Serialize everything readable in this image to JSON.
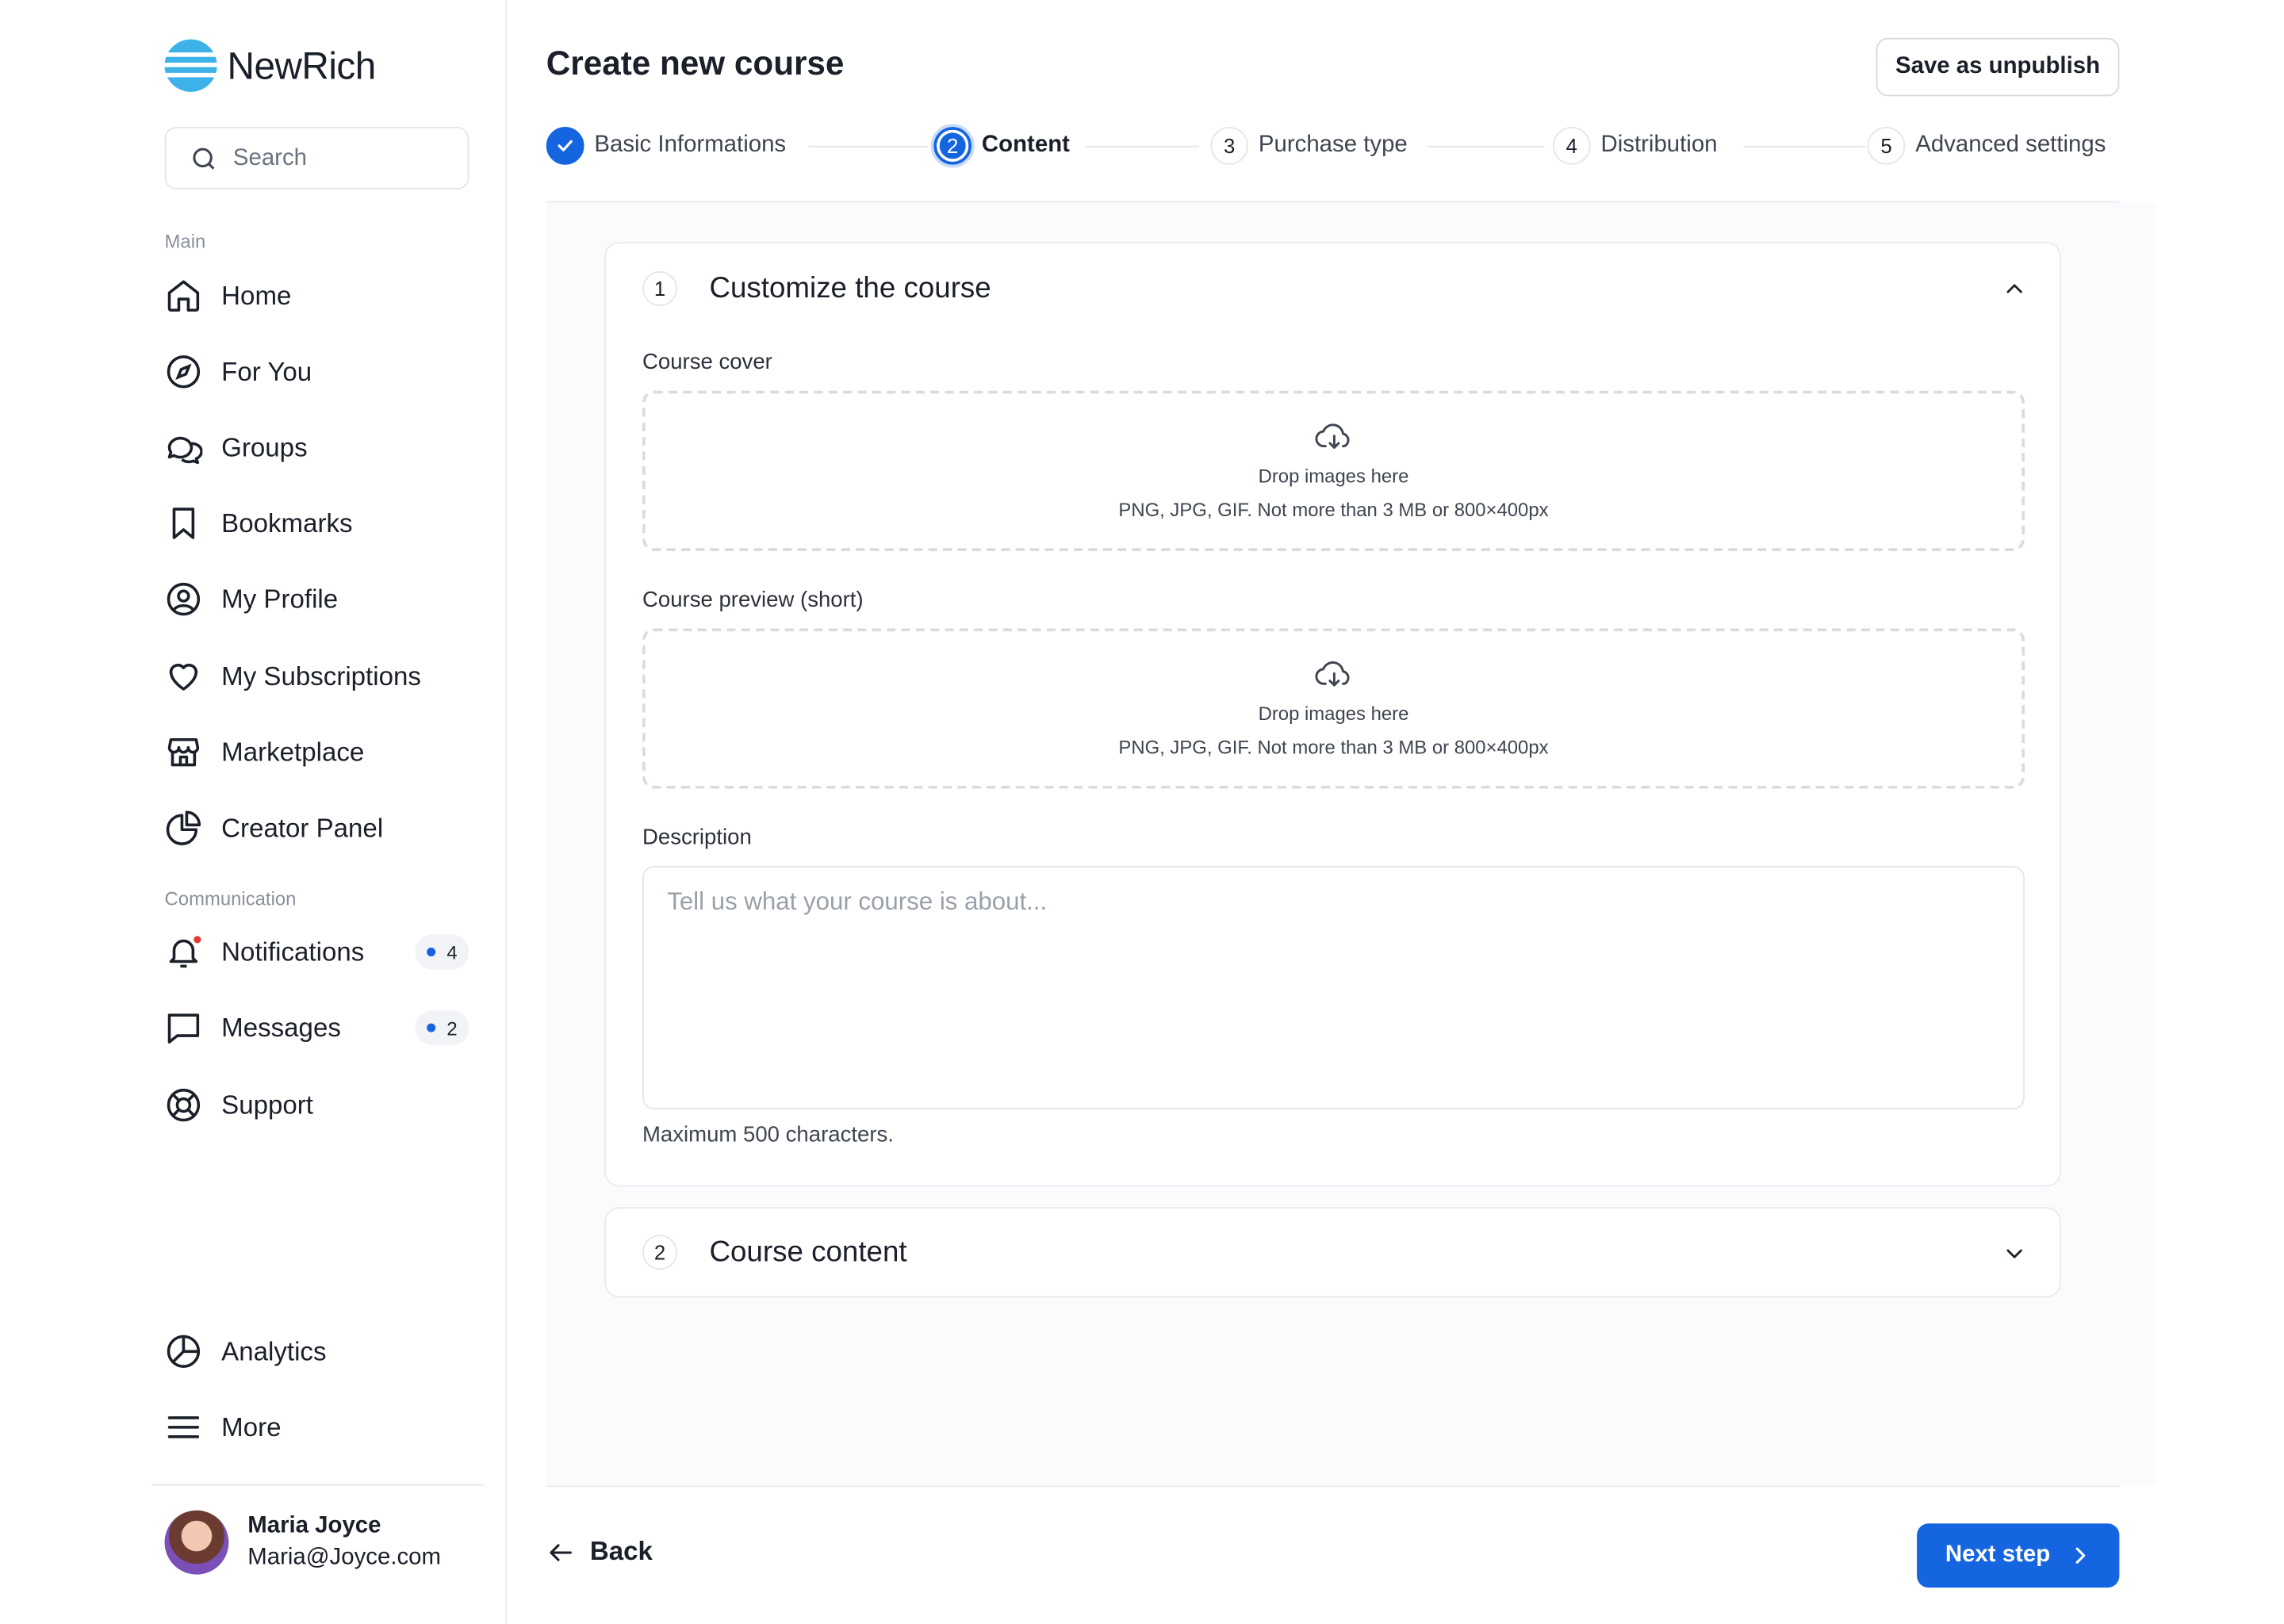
{
  "brand": {
    "name": "NewRich",
    "accent": "#3db2e8"
  },
  "search": {
    "placeholder": "Search"
  },
  "sidebar": {
    "main_label": "Main",
    "main_items": [
      {
        "label": "Home",
        "icon": "home-icon"
      },
      {
        "label": "For You",
        "icon": "compass-icon"
      },
      {
        "label": "Groups",
        "icon": "chat-bubbles-icon"
      },
      {
        "label": "Bookmarks",
        "icon": "bookmark-icon"
      },
      {
        "label": "My Profile",
        "icon": "user-circle-icon"
      },
      {
        "label": "My Subscriptions",
        "icon": "heart-icon"
      },
      {
        "label": "Marketplace",
        "icon": "store-icon"
      },
      {
        "label": "Creator Panel",
        "icon": "pie-chart-icon"
      }
    ],
    "communication_label": "Communication",
    "communication_items": [
      {
        "label": "Notifications",
        "icon": "bell-icon",
        "badge": "4"
      },
      {
        "label": "Messages",
        "icon": "message-icon",
        "badge": "2"
      },
      {
        "label": "Support",
        "icon": "lifebuoy-icon"
      }
    ],
    "bottom_items": [
      {
        "label": "Analytics",
        "icon": "analytics-icon"
      },
      {
        "label": "More",
        "icon": "menu-icon"
      }
    ],
    "user": {
      "name": "Maria Joyce",
      "email": "Maria@Joyce.com"
    }
  },
  "header": {
    "title": "Create new course",
    "save_label": "Save as unpublish"
  },
  "steps": [
    {
      "number": "1",
      "label": "Basic Informations",
      "state": "done"
    },
    {
      "number": "2",
      "label": "Content",
      "state": "active"
    },
    {
      "number": "3",
      "label": "Purchase type",
      "state": "pending"
    },
    {
      "number": "4",
      "label": "Distribution",
      "state": "pending"
    },
    {
      "number": "5",
      "label": "Advanced settings",
      "state": "pending"
    }
  ],
  "sections": {
    "customize": {
      "number": "1",
      "title": "Customize the course",
      "cover_label": "Course cover",
      "preview_label": "Course preview (short)",
      "dropzone_title": "Drop images here",
      "dropzone_hint": "PNG, JPG, GIF. Not more than 3 MB or 800×400px",
      "description_label": "Description",
      "description_placeholder": "Tell us what your course is about...",
      "description_hint": "Maximum 500 characters."
    },
    "content": {
      "number": "2",
      "title": "Course content"
    }
  },
  "footer": {
    "back_label": "Back",
    "next_label": "Next step"
  },
  "colors": {
    "primary": "#1565e0",
    "notification_dot": "#e53935"
  }
}
